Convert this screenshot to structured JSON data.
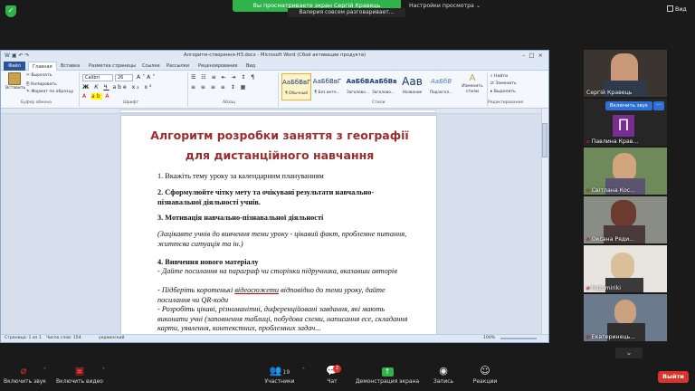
{
  "zoom": {
    "sharing_banner": "Вы просматриваете экран Сергій Кравець",
    "view_options": "Настройки просмотра",
    "talking_banner": "Валерия совсем разговаривает...",
    "view_button": "Вид",
    "enable_sound_button": "Включить звук",
    "more_button": "···",
    "participants": [
      {
        "name": "Сергій Кравець",
        "muted": false
      },
      {
        "name": "Павлина Крав...",
        "muted": true,
        "initial": "П"
      },
      {
        "name": "Світлана Кос...",
        "muted": true
      },
      {
        "name": "Оксана Ряди...",
        "muted": true
      },
      {
        "name": "hozumiriki",
        "muted": true
      },
      {
        "name": "Екатеринець...",
        "muted": true
      }
    ],
    "scroll_down": "⌄",
    "toolbar": {
      "mute": "Включить звук",
      "video": "Включить видео",
      "participants": "Участники",
      "participants_count": "19",
      "chat": "Чат",
      "chat_badge": "2",
      "share": "Демонстрация экрана",
      "record": "Запись",
      "reactions": "Реакции",
      "leave": "Выйти"
    },
    "colors": {
      "accent_green": "#2fb34a",
      "leave_red": "#d9342b",
      "participant_purple": "#7a2d90"
    }
  },
  "word": {
    "title": "Алгоритм-створення-НЗ.docx - Microsoft Word (Сбой активации продукта)",
    "tabs": [
      "Файл",
      "Главная",
      "Вставка",
      "Разметка страницы",
      "Ссылки",
      "Рассылки",
      "Рецензирование",
      "Вид"
    ],
    "clipboard": {
      "paste": "Вставить",
      "cut": "Вырезать",
      "copy": "Копировать",
      "format_painter": "Формат по образцу",
      "group": "Буфер обмена"
    },
    "font": {
      "name": "Calibri",
      "size": "26",
      "group": "Шрифт"
    },
    "paragraph_group": "Абзац",
    "styles": [
      {
        "sample": "АаБбВвГ",
        "name": "¶ Обычный",
        "selected": true
      },
      {
        "sample": "АаБбВвГ",
        "name": "¶ Без инте...",
        "selected": false
      },
      {
        "sample": "АаБбВ",
        "name": "Заголово...",
        "selected": false
      },
      {
        "sample": "АаБбВв",
        "name": "Заголово...",
        "selected": false
      },
      {
        "sample": "Аав",
        "name": "Название",
        "selected": false
      },
      {
        "sample": "АаБбВ",
        "name": "Подзагол...",
        "selected": false
      }
    ],
    "styles_group": "Стили",
    "change_styles": "Изменить стили",
    "editing": {
      "find": "Найти",
      "replace": "Заменить",
      "select": "Выделить",
      "group": "Редактирование"
    },
    "status": {
      "page": "Страница: 1 из 1",
      "words": "Число слов: 154",
      "lang": "украинский",
      "zoom": "100%"
    },
    "doc": {
      "title_line1": "Алгоритм розробки заняття з географії",
      "title_line2": "для дистанційного навчання",
      "p1": "1. Вкажіть тему уроку за календарним плануванням",
      "p2": "2. Сформулюйте чітку мету та очікувані результати навчально-пізнавальної діяльності учнів.",
      "p3": "3. Мотивація навчально-пізнавальної діяльності",
      "p4": "(Зацікавте учнів до вивчення теми уроку - цікавий факт, проблемне питання, життєва ситуація та ін.)",
      "p5": "4. Вивчення нового матеріалу",
      "p6": "- Дайте посилання на параграф чи сторінки підручника, вказавши авторів",
      "p7a": "- Підберіть коротенькі ",
      "p7u": "відеосюжети",
      "p7b": " відповідно до теми уроку, дайте посилання чи QR-коди",
      "p8": "- Розробіть цікаві, різноманітні, диференційовані завдання, які мають виконати учні (заповнення таблиці, побудова схеми, написання есе, складання карти, уявлення, контекстних, проблемних задач..."
    }
  }
}
